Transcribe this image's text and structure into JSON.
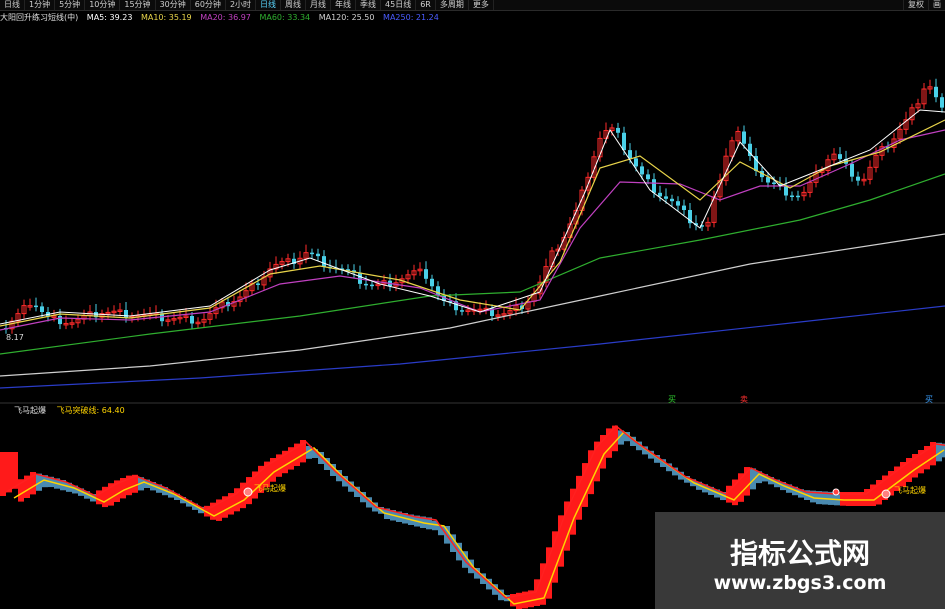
{
  "toolbar": {
    "left_items": [
      "日线",
      "1分钟",
      "5分钟",
      "10分钟",
      "15分钟",
      "30分钟",
      "60分钟",
      "2小时",
      "日线",
      "周线",
      "月线",
      "年线",
      "季线",
      "45日线",
      "6R",
      "多周期",
      "更多"
    ],
    "active_index": 8,
    "right_items": [
      "复权",
      "画"
    ]
  },
  "ma_bar": {
    "title": "大阳回升练习短线(中)",
    "ma5": "MA5: 39.23",
    "ma10": "MA10: 35.19",
    "ma20": "MA20: 36.97",
    "ma60": "MA60: 33.34",
    "ma120": "MA120: 25.50",
    "ma250": "MA250: 21.24"
  },
  "colors": {
    "up": "#ff2b2b",
    "down": "#4ad0e8",
    "ma5": "#ffffff",
    "ma10": "#e8d44a",
    "ma20": "#c040c0",
    "ma60": "#2fae2f",
    "ma120": "#cfcfcf",
    "ma250": "#2a3cc8",
    "ind_up": "#ff1a1a",
    "ind_down": "#4a8ab0",
    "ind_yellow": "#ffd400",
    "ind_red_line": "#ff2020"
  },
  "main_labels": {
    "low_price": "8.17",
    "signal_buy": "买",
    "signal_sell": "卖",
    "signal_right": "买"
  },
  "indicator": {
    "name": "飞马起爆",
    "value_label": "飞马突破线: 64.40",
    "marker_1": "飞马起爆",
    "marker_2": "飞马起爆"
  },
  "watermark": {
    "title": "指标公式网",
    "url": "www.zbgs3.com"
  }
}
